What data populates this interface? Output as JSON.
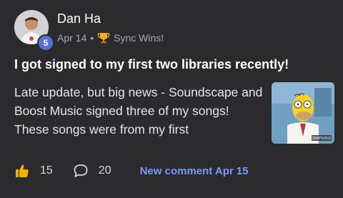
{
  "post": {
    "author": "Dan Ha",
    "level_badge": "5",
    "date": "Apr 14",
    "separator": "•",
    "category": "Sync Wins!",
    "title": "I got signed to my first two libraries recently!",
    "body": "Late update, but big news - Soundscape and Boost Music signed three of my songs! These songs were from my first",
    "thumbnail_caption": "SIMPSONS"
  },
  "footer": {
    "likes": "15",
    "comments": "20",
    "new_comment": "New comment Apr 15"
  },
  "colors": {
    "background": "#2b2b2d",
    "accent": "#7b9bf2",
    "badge": "#5a6ed6",
    "like_icon": "#f5b400"
  }
}
